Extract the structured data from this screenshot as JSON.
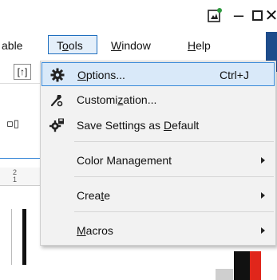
{
  "titlebar": {
    "app_icon": "document-edit-icon",
    "minimize_glyph": "–",
    "close_glyph": "✕"
  },
  "menubar": {
    "items": [
      {
        "label": "Table",
        "display": "able"
      },
      {
        "label": "Tools",
        "prefix": "T",
        "mnemonic": "o",
        "suffix": "ols"
      },
      {
        "label": "Window",
        "mnemonic": "W",
        "suffix": "indow"
      },
      {
        "label": "Help",
        "mnemonic": "H",
        "suffix": "elp"
      }
    ]
  },
  "background": {
    "toolbar_glyph": "[↑]",
    "ruler_mark_top": "2",
    "ruler_mark_bottom": "1"
  },
  "tools_menu": {
    "items": [
      {
        "id": "options",
        "label": "Options...",
        "mnemonic": "O",
        "rest": "ptions...",
        "shortcut": "Ctrl+J",
        "icon": "gear-icon",
        "highlighted": true
      },
      {
        "id": "customization",
        "label": "Customization...",
        "before": "Customi",
        "mnemonic": "z",
        "after": "ation...",
        "icon": "wrench-icon"
      },
      {
        "id": "save-default",
        "label": "Save Settings as Default",
        "before": "Save Settings as ",
        "mnemonic": "D",
        "after": "efault",
        "icon": "gear-save-icon"
      },
      {
        "id": "color-management",
        "label": "Color Management",
        "submenu": true
      },
      {
        "id": "create",
        "label": "Create",
        "before": "Crea",
        "mnemonic": "t",
        "after": "e",
        "submenu": true
      },
      {
        "id": "macros",
        "label": "Macros",
        "mnemonic": "M",
        "rest": "acros",
        "submenu": true
      }
    ]
  },
  "colors": {
    "highlight_bg": "#d9e9f9",
    "highlight_border": "#3a8ad9",
    "menu_bg": "#f2f2f2",
    "accent_red": "#e0261b"
  }
}
